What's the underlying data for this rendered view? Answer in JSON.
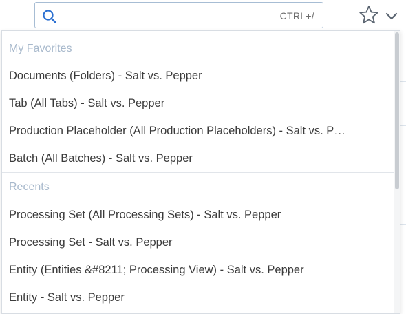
{
  "search": {
    "placeholder": "",
    "value": "",
    "shortcut": "CTRL+/"
  },
  "icons": {
    "search": "search-icon",
    "favorite": "star-icon",
    "expand": "chevron-down-icon"
  },
  "colors": {
    "accent": "#2a6fd1",
    "section_header": "#a8b9cc",
    "item_text": "#3b3b3b"
  },
  "dropdown": {
    "favorites": {
      "header": "My Favorites",
      "items": [
        "Documents (Folders) - Salt vs. Pepper",
        "Tab (All Tabs) - Salt vs. Pepper",
        "Production Placeholder (All Production Placeholders) - Salt vs. P…",
        "Batch (All Batches) - Salt vs. Pepper"
      ]
    },
    "recents": {
      "header": "Recents",
      "items": [
        "Processing Set (All Processing Sets) - Salt vs. Pepper",
        "Processing Set - Salt vs. Pepper",
        "Entity (Entities &#8211; Processing View) - Salt vs. Pepper",
        "Entity - Salt vs. Pepper"
      ]
    }
  }
}
